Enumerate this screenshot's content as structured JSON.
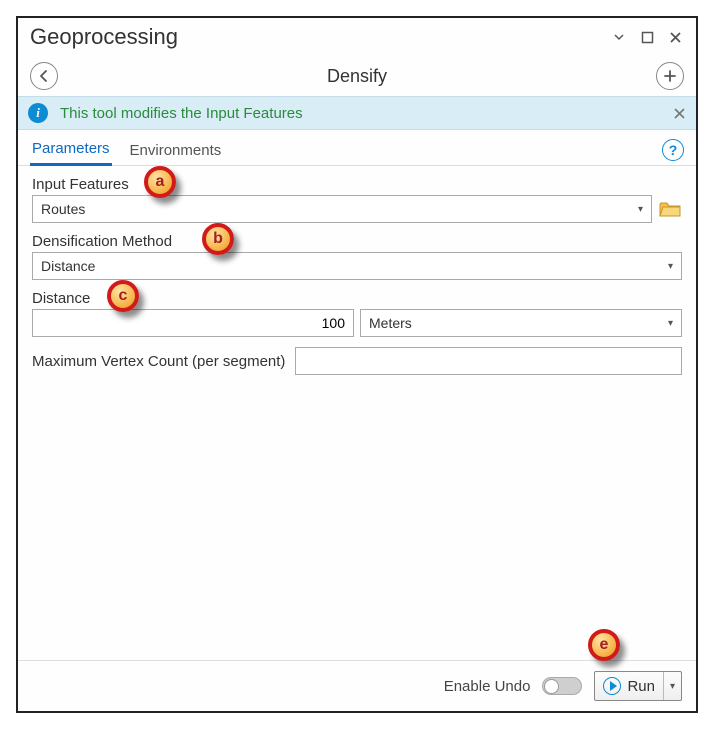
{
  "window": {
    "title": "Geoprocessing",
    "tool_name": "Densify"
  },
  "info": {
    "message": "This tool modifies the Input Features"
  },
  "tabs": {
    "parameters": "Parameters",
    "environments": "Environments"
  },
  "fields": {
    "input_features": {
      "label": "Input Features",
      "value": "Routes"
    },
    "method": {
      "label": "Densification Method",
      "value": "Distance"
    },
    "distance": {
      "label": "Distance",
      "value": "100",
      "unit": "Meters"
    },
    "max_vertex": {
      "label": "Maximum Vertex Count (per segment)",
      "value": ""
    }
  },
  "footer": {
    "undo_label": "Enable Undo",
    "run_label": "Run"
  },
  "callouts": {
    "a": "a",
    "b": "b",
    "c": "c",
    "e": "e"
  }
}
